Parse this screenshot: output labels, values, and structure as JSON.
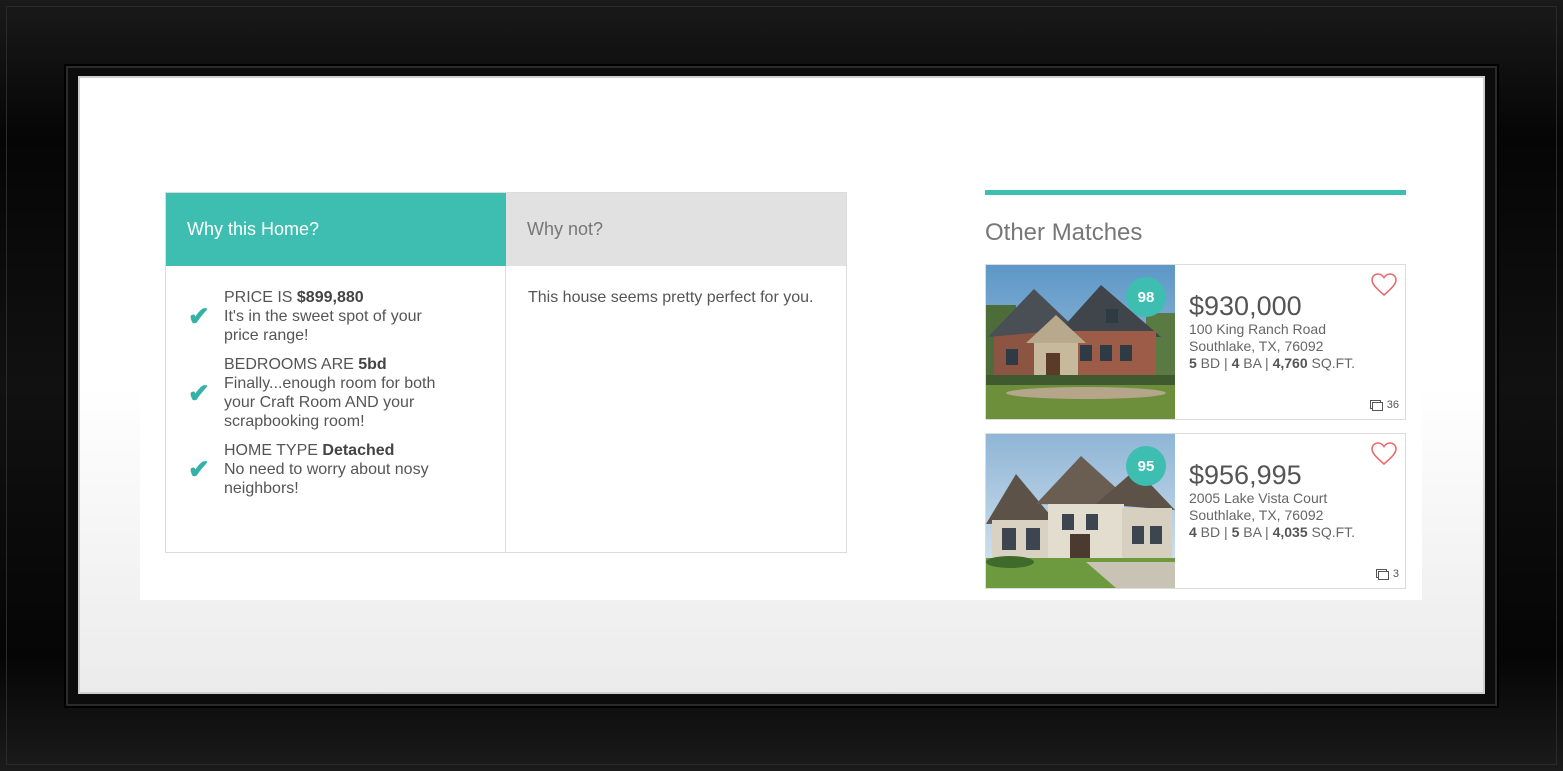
{
  "why_panel": {
    "tab_why": "Why this Home?",
    "tab_why_not": "Why not?",
    "reasons": [
      {
        "label": "PRICE IS ",
        "value": "$899,880",
        "desc": "It's in the sweet spot of your price range!"
      },
      {
        "label": "BEDROOMS ARE ",
        "value": "5bd",
        "desc": "Finally...enough room for both your Craft Room AND your scrapbooking room!"
      },
      {
        "label": "HOME TYPE ",
        "value": "Detached",
        "desc": "No need to worry about nosy neighbors!"
      }
    ],
    "why_not_text": "This house seems pretty perfect for you."
  },
  "matches": {
    "title": "Other Matches",
    "cards": [
      {
        "score": "98",
        "price": "$930,000",
        "street": "100 King Ranch Road",
        "city": "Southlake, TX, 76092",
        "beds": "5",
        "beds_unit": " BD | ",
        "baths": "4",
        "baths_unit": " BA | ",
        "sqft": "4,760",
        "sqft_unit": " SQ.FT.",
        "photo_count": "36"
      },
      {
        "score": "95",
        "price": "$956,995",
        "street": "2005 Lake Vista Court",
        "city": "Southlake, TX, 76092",
        "beds": "4",
        "beds_unit": " BD | ",
        "baths": "5",
        "baths_unit": " BA | ",
        "sqft": "4,035",
        "sqft_unit": " SQ.FT.",
        "photo_count": "3"
      }
    ]
  },
  "colors": {
    "accent": "#3ebdb1",
    "heart": "#e86b6b",
    "inactive_tab": "#e1e1e1"
  },
  "icons": {
    "check": "check-icon",
    "heart": "heart-icon",
    "photos": "photos-icon"
  }
}
